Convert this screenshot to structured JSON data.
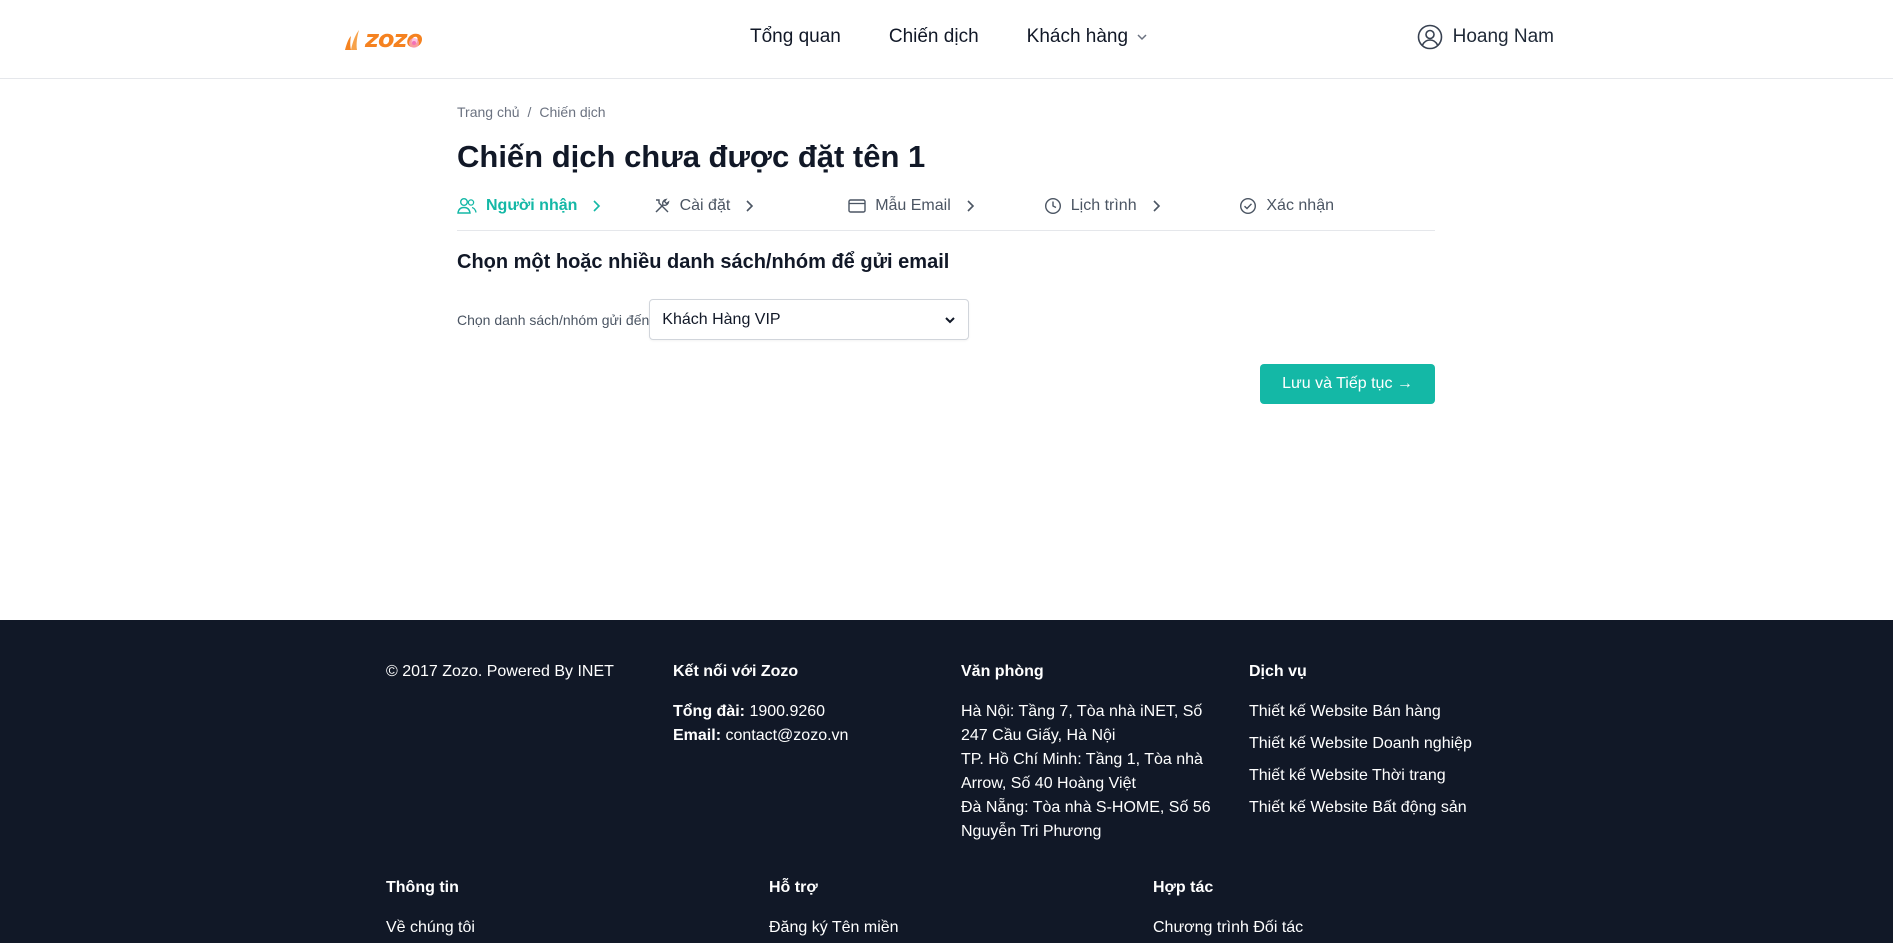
{
  "header": {
    "logo_text": "zozo",
    "nav": [
      {
        "label": "Tổng quan"
      },
      {
        "label": "Chiến dịch"
      },
      {
        "label": "Khách hàng"
      }
    ],
    "user_name": "Hoang Nam"
  },
  "breadcrumb": {
    "home": "Trang chủ",
    "separator": "/",
    "current": "Chiến dịch"
  },
  "page_title": "Chiến dịch chưa được đặt tên 1",
  "steps": [
    {
      "label": "Người nhận",
      "active": true
    },
    {
      "label": "Cài đặt",
      "active": false
    },
    {
      "label": "Mẫu Email",
      "active": false
    },
    {
      "label": "Lịch trình",
      "active": false
    },
    {
      "label": "Xác nhận",
      "active": false
    }
  ],
  "section_title": "Chọn một hoặc nhiều danh sách/nhóm để gửi email",
  "list_field": {
    "label": "Chọn danh sách/nhóm gửi đến",
    "selected": "Khách Hàng VIP"
  },
  "save_button": "Lưu và Tiếp tục →",
  "footer": {
    "copyright": "© 2017 Zozo. Powered By INET",
    "connect": {
      "title": "Kết nối với Zozo",
      "hotline_label": "Tổng đài:",
      "hotline": "1900.9260",
      "email_label": "Email:",
      "email": "contact@zozo.vn"
    },
    "office": {
      "title": "Văn phòng",
      "lines": [
        "Hà Nội: Tầng 7, Tòa nhà iNET, Số",
        "247 Cầu Giấy, Hà Nội",
        "TP. Hồ Chí Minh: Tầng 1, Tòa nhà",
        "Arrow, Số 40 Hoàng Việt",
        "Đà Nẵng: Tòa nhà S-HOME, Số 56",
        "Nguyễn Tri Phương"
      ]
    },
    "services": {
      "title": "Dịch vụ",
      "links": [
        "Thiết kế Website Bán hàng",
        "Thiết kế Website Doanh nghiệp",
        "Thiết kế Website Thời trang",
        "Thiết kế Website Bất động sản"
      ]
    },
    "info": {
      "title": "Thông tin",
      "links": [
        "Về chúng tôi"
      ]
    },
    "support": {
      "title": "Hỗ trợ",
      "links": [
        "Đăng ký Tên miền"
      ]
    },
    "partner": {
      "title": "Hợp tác",
      "links": [
        "Chương trình Đối tác"
      ]
    }
  },
  "colors": {
    "accent": "#14b8a6",
    "brand_orange": "#f58220",
    "footer_bg": "#111827"
  }
}
